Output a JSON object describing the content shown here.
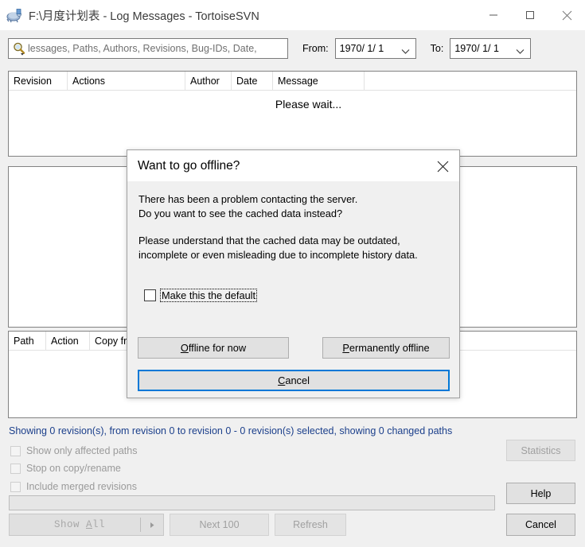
{
  "window": {
    "title": "F:\\月度计划表 - Log Messages - TortoiseSVN",
    "icon": "tortoisesvn-icon",
    "minimize": "minimize-icon",
    "maximize": "maximize-icon",
    "close": "close-icon"
  },
  "toolbar": {
    "search_placeholder": "lessages, Paths, Authors, Revisions, Bug-IDs, Date,",
    "search_icon": "search-icon",
    "from_label": "From:",
    "from_value": "1970/ 1/ 1",
    "to_label": "To:",
    "to_value": "1970/ 1/ 1"
  },
  "log_list": {
    "columns": [
      "Revision",
      "Actions",
      "Author",
      "Date",
      "Message"
    ],
    "empty_text": "Please wait..."
  },
  "changed_paths": {
    "columns": [
      "Path",
      "Action",
      "Copy fr"
    ]
  },
  "status": {
    "text": "Showing 0 revision(s), from revision 0 to revision 0 - 0 revision(s) selected, showing 0 changed paths",
    "color": "#1b3f8b"
  },
  "options": [
    {
      "label": "Show only affected paths",
      "checked": false,
      "disabled": true
    },
    {
      "label": "Stop on copy/rename",
      "checked": false,
      "disabled": true
    },
    {
      "label": "Include merged revisions",
      "checked": false,
      "disabled": true
    }
  ],
  "buttons": {
    "statistics": "Statistics",
    "help": "Help",
    "cancel": "Cancel",
    "show_all": "Show All",
    "show_all_accel": "A",
    "next_100": "Next 100",
    "refresh": "Refresh"
  },
  "dialog": {
    "title": "Want to go offline?",
    "close_icon": "close-icon",
    "paragraph1": "There has been a problem contacting the server.\nDo you want to see the cached data instead?",
    "paragraph2": "Please understand that the cached data may be outdated,\nincomplete or even misleading due to incomplete history data.",
    "checkbox_label": "Make this the default",
    "checkbox_checked": false,
    "btn_offline_now": "Offline for now",
    "btn_offline_now_accel": "O",
    "btn_permanently_offline": "Permanently offline",
    "btn_permanently_offline_accel": "P",
    "btn_cancel": "Cancel",
    "btn_cancel_accel": "C",
    "focus_color": "#0078d7"
  }
}
